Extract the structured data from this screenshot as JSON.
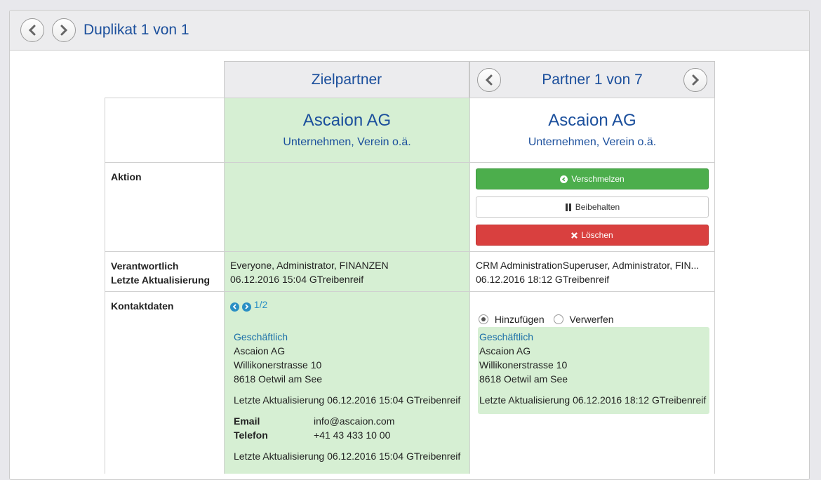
{
  "header": {
    "title": "Duplikat 1 von 1",
    "prev_icon": "chevron-left-icon",
    "next_icon": "chevron-right-icon"
  },
  "columns": {
    "target_title": "Zielpartner",
    "partner_title": "Partner 1 von 7"
  },
  "target": {
    "name": "Ascaion AG",
    "type": "Unternehmen, Verein o.ä."
  },
  "partner": {
    "name": "Ascaion AG",
    "type": "Unternehmen, Verein o.ä."
  },
  "labels": {
    "aktion": "Aktion",
    "verantwortlich": "Verantwortlich",
    "letzte_aktualisierung": "Letzte Aktualisierung",
    "kontaktdaten": "Kontaktdaten"
  },
  "actions": {
    "merge": "Verschmelzen",
    "keep": "Beibehalten",
    "delete": "Löschen"
  },
  "responsible": {
    "target": "Everyone, Administrator, FINANZEN",
    "target_updated": "06.12.2016 15:04 GTreibenreif",
    "partner": "CRM AdministrationSuperuser, Administrator, FIN...",
    "partner_updated": "06.12.2016 18:12 GTreibenreif"
  },
  "contact": {
    "pager": "1/2",
    "target": {
      "kind": "Geschäftlich",
      "line1": "Ascaion AG",
      "line2": "Willikonerstrasse 10",
      "line3": "8618 Oetwil am See",
      "updated": "Letzte Aktualisierung 06.12.2016 15:04 GTreibenreif",
      "email_label": "Email",
      "email": "info@ascaion.com",
      "phone_label": "Telefon",
      "phone": "+41 43 433 10 00",
      "updated2": "Letzte Aktualisierung 06.12.2016 15:04 GTreibenreif"
    },
    "partner": {
      "radio_add": "Hinzufügen",
      "radio_discard": "Verwerfen",
      "selected": "Hinzufügen",
      "kind": "Geschäftlich",
      "line1": "Ascaion AG",
      "line2": "Willikonerstrasse 10",
      "line3": "8618 Oetwil am See",
      "updated": "Letzte Aktualisierung 06.12.2016 18:12 GTreibenreif"
    }
  },
  "colors": {
    "accent": "#1b4f9c",
    "green_bg": "#d6efd3",
    "merge": "#4cae4c",
    "delete": "#d9403f"
  }
}
